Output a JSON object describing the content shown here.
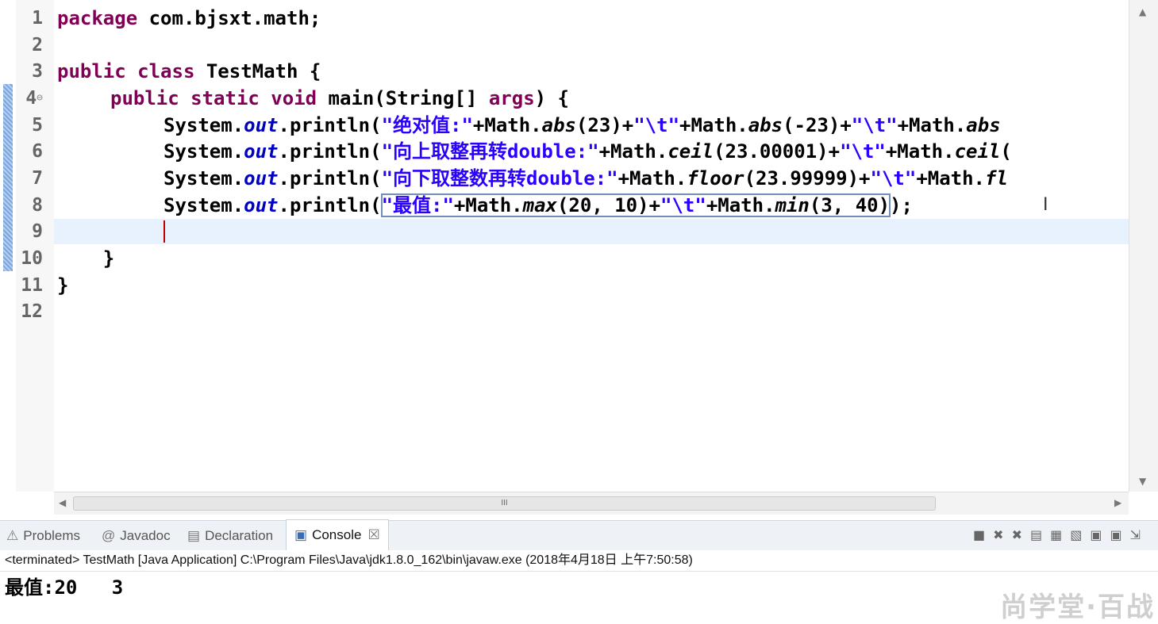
{
  "editor": {
    "lines": [
      {
        "n": "1"
      },
      {
        "n": "2"
      },
      {
        "n": "3"
      },
      {
        "n": "4"
      },
      {
        "n": "5"
      },
      {
        "n": "6"
      },
      {
        "n": "7"
      },
      {
        "n": "8"
      },
      {
        "n": "9"
      },
      {
        "n": "10"
      },
      {
        "n": "11"
      },
      {
        "n": "12"
      }
    ],
    "code": {
      "l1_kw": "package",
      "l1_rest": " com.bjsxt.math;",
      "l3_kw": "public class",
      "l3_rest": " TestMath {",
      "l4_kw": "public static void",
      "l4_rest1": " main(String[] ",
      "l4_args": "args",
      "l4_rest2": ") {",
      "sys": "System.",
      "out": "out",
      "println": ".println(",
      "l5_s1": "\"绝对值:\"",
      "l5_r1": "+Math.",
      "l5_m1": "abs",
      "l5_r2": "(23)+",
      "l5_s2": "\"\\t\"",
      "l5_r3": "+Math.",
      "l5_m2": "abs",
      "l5_r4": "(-23)+",
      "l5_s3": "\"\\t\"",
      "l5_r5": "+Math.",
      "l5_m3": "abs",
      "l6_s1": "\"向上取整再转double:\"",
      "l6_r1": "+Math.",
      "l6_m1": "ceil",
      "l6_r2": "(23.00001)+",
      "l6_s2": "\"\\t\"",
      "l6_r3": "+Math.",
      "l6_m2": "ceil",
      "l6_r4": "(",
      "l7_s1": "\"向下取整数再转double:\"",
      "l7_r1": "+Math.",
      "l7_m1": "floor",
      "l7_r2": "(23.99999)+",
      "l7_s2": "\"\\t\"",
      "l7_r3": "+Math.",
      "l7_m2": "fl",
      "l8_s1": "\"最值:\"",
      "l8_r1": "+Math.",
      "l8_m1": "max",
      "l8_r2": "(20, 10)+",
      "l8_s2": "\"\\t\"",
      "l8_r3": "+Math.",
      "l8_m2": "min",
      "l8_r4": "(3, 40)",
      "l8_end": ");",
      "l10": "    }",
      "l11": "}"
    }
  },
  "scroll": {
    "thumb_label": "III"
  },
  "tabs": [
    {
      "label": "Problems",
      "icon": "problems-icon"
    },
    {
      "label": "Javadoc",
      "icon": "javadoc-icon"
    },
    {
      "label": "Declaration",
      "icon": "declaration-icon"
    },
    {
      "label": "Console",
      "icon": "console-icon",
      "active": true
    }
  ],
  "console": {
    "close_glyph": "☒",
    "status": "<terminated> TestMath [Java Application] C:\\Program Files\\Java\\jdk1.8.0_162\\bin\\javaw.exe (2018年4月18日 上午7:50:58)",
    "output": "最值:20   3"
  },
  "watermark": "尚学堂·百战"
}
